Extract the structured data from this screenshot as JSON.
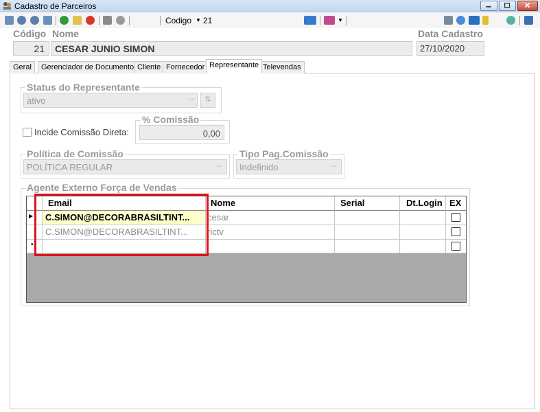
{
  "window": {
    "title": "Cadastro de Parceiros"
  },
  "toolbar": {
    "codigo_label": "Codigo",
    "codigo_value": "21"
  },
  "header": {
    "codigo_label": "Código",
    "nome_label": "Nome",
    "data_label": "Data Cadastro",
    "codigo_value": "21",
    "nome_value": "CESAR JUNIO SIMON",
    "data_value": "27/10/2020"
  },
  "tabs": [
    {
      "label": "Geral"
    },
    {
      "label": "Gerenciador de Documentos"
    },
    {
      "label": "Cliente"
    },
    {
      "label": "Fornecedor"
    },
    {
      "label": "Representante"
    },
    {
      "label": "Televendas"
    }
  ],
  "representante": {
    "status_title": "Status do Representante",
    "status_value": "ativo",
    "incide_label": "Incide Comissão Direta:",
    "comissao_title": "% Comissão",
    "comissao_value": "0,00",
    "politica_title": "Política de Comissão",
    "politica_value": "POLÍTICA REGULAR",
    "tipo_title": "Tipo Pag.Comissão",
    "tipo_value": "Indefinido",
    "agente_title": "Agente Externo Força de Vendas"
  },
  "grid": {
    "columns": [
      "Email",
      "Nome",
      "Serial",
      "Dt.Login",
      "EX"
    ],
    "rows": [
      {
        "email": "C.SIMON@DECORABRASILTINT...",
        "nome": "cesar",
        "serial": "",
        "dtlogin": ""
      },
      {
        "email": "C.SIMON@DECORABRASILTINT...",
        "nome": "rictv",
        "serial": "",
        "dtlogin": ""
      }
    ]
  },
  "colors": {
    "highlight": "#e0101a",
    "selected_row": "#ffffcc"
  }
}
